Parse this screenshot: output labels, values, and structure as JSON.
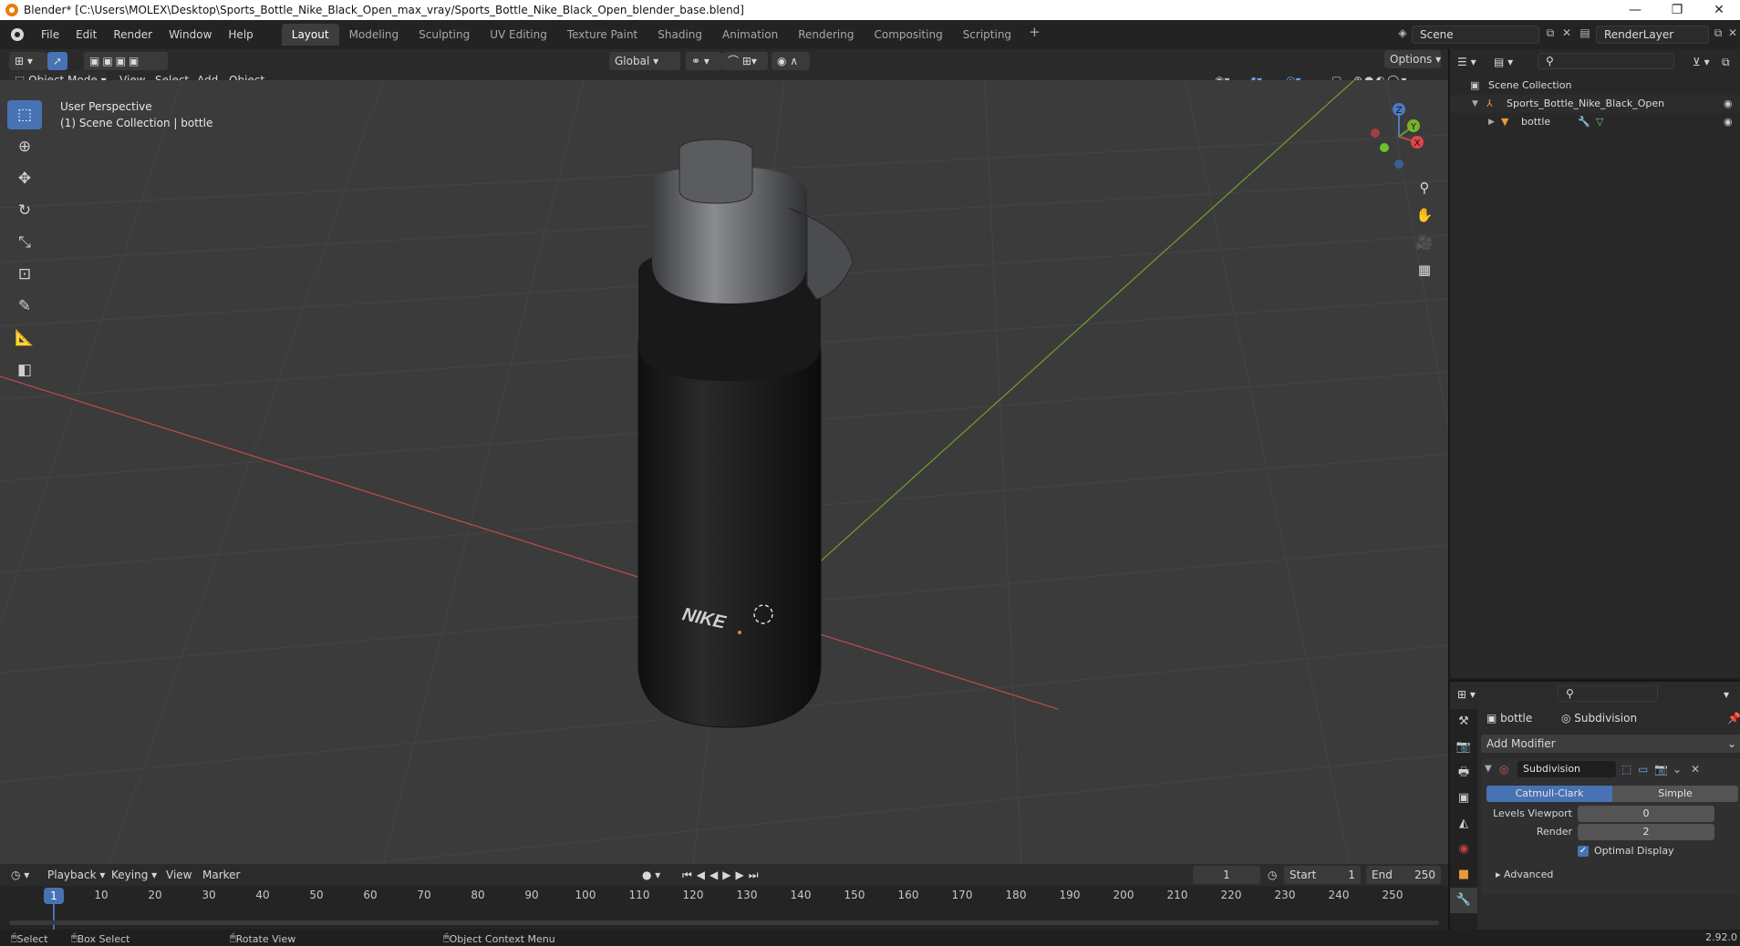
{
  "window": {
    "title": "Blender* [C:\\Users\\MOLEX\\Desktop\\Sports_Bottle_Nike_Black_Open_max_vray/Sports_Bottle_Nike_Black_Open_blender_base.blend]",
    "minimize": "—",
    "restore": "❐",
    "close": "✕"
  },
  "menubar": {
    "items": [
      "File",
      "Edit",
      "Render",
      "Window",
      "Help"
    ],
    "workspaces": [
      "Layout",
      "Modeling",
      "Sculpting",
      "UV Editing",
      "Texture Paint",
      "Shading",
      "Animation",
      "Rendering",
      "Compositing",
      "Scripting"
    ],
    "active_workspace": "Layout",
    "add_workspace": "+",
    "scene": "Scene",
    "render_layer": "RenderLayer"
  },
  "viewport_header": {
    "mode": "Object Mode",
    "menus": [
      "View",
      "Select",
      "Add",
      "Object"
    ],
    "transform_orientation": "Global",
    "options": "Options"
  },
  "viewport": {
    "perspective": "User Perspective",
    "collection_info": "(1) Scene Collection | bottle",
    "logo_text": "NIKE",
    "gizmo_axes": {
      "x": "X",
      "y": "Y",
      "z": "Z"
    }
  },
  "outliner": {
    "root": "Scene Collection",
    "collection": "Sports_Bottle_Nike_Black_Open",
    "object": "bottle"
  },
  "properties": {
    "object": "bottle",
    "modifier_breadcrumb": "Subdivision",
    "add_modifier": "Add Modifier",
    "modifier_name": "Subdivision",
    "algorithms": [
      "Catmull-Clark",
      "Simple"
    ],
    "active_algorithm": "Catmull-Clark",
    "levels_viewport_label": "Levels Viewport",
    "levels_viewport": "0",
    "render_label": "Render",
    "render": "2",
    "optimal_display": "Optimal Display",
    "advanced": "Advanced"
  },
  "timeline": {
    "menus": [
      "Playback",
      "Keying",
      "View",
      "Marker"
    ],
    "current_frame": "1",
    "start_label": "Start",
    "start": "1",
    "end_label": "End",
    "end": "250",
    "ticks": [
      "10",
      "20",
      "30",
      "40",
      "50",
      "60",
      "70",
      "80",
      "90",
      "100",
      "110",
      "120",
      "130",
      "140",
      "150",
      "160",
      "170",
      "180",
      "190",
      "200",
      "210",
      "220",
      "230",
      "240",
      "250"
    ],
    "frame_marker": "1"
  },
  "statusbar": {
    "select": "Select",
    "box_select": "Box Select",
    "rotate_view": "Rotate View",
    "context_menu": "Object Context Menu",
    "version": "2.92.0"
  },
  "colors": {
    "accent": "#4772b3",
    "x_axis": "#b84a4a",
    "y_axis": "#6f9a2a",
    "z_axis": "#4a7cc6"
  }
}
